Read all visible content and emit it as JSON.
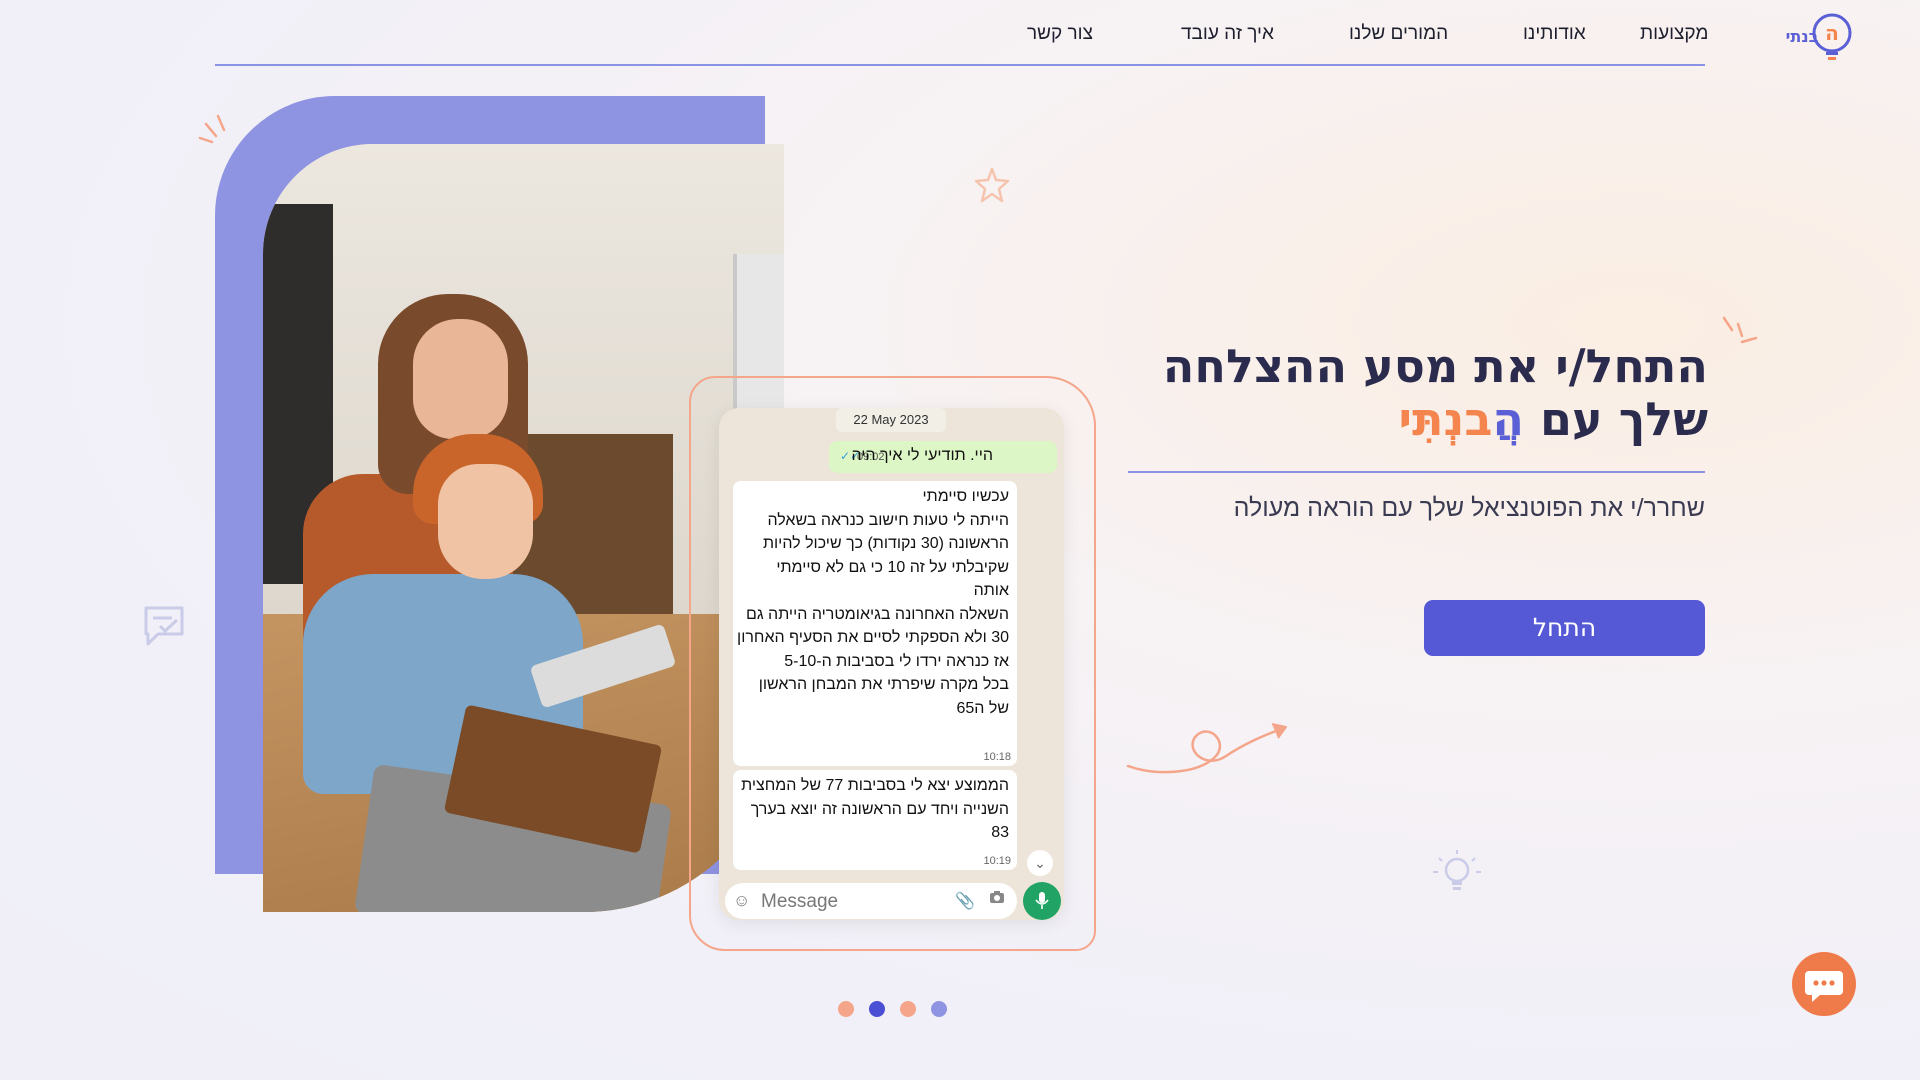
{
  "brand": {
    "logo_name": "הַבְנָתִי"
  },
  "nav": {
    "items": [
      {
        "label": "מקצועות"
      },
      {
        "label": "אודותינו"
      },
      {
        "label": "המורים שלנו"
      },
      {
        "label": "איך זה עובד"
      },
      {
        "label": "צור קשר"
      }
    ]
  },
  "hero": {
    "title_line1": "התחל/י את מסע ההצלחה",
    "title_line2_prefix": "שלך עם",
    "brand_part1": "הֲ",
    "brand_part2": "בנְתִּי",
    "subtitle": "שחרר/י את הפוטנציאל שלך עם הוראה  מעולה",
    "cta_label": "התחל"
  },
  "chat": {
    "date": "22 May 2023",
    "outgoing": {
      "text": "היי. תודיעי לי איך היה",
      "time": "09:02",
      "ticks": "✓✓"
    },
    "incoming": [
      {
        "text": "עכשיו סיימתי\nהייתה לי טעות חישוב כנראה בשאלה הראשונה (30 נקודות) כך שיכול להיות שקיבלתי על זה 10 כי גם לא סיימתי אותה\nהשאלה האחרונה בגיאומטריה הייתה גם 30 ולא הספקתי לסיים את הסעיף האחרון אז כנראה ירדו לי בסביבות ה-5-10\nבכל מקרה שיפרתי את המבחן הראשון של ה65",
        "time": "10:18"
      },
      {
        "text": "הממוצע יצא לי בסביבות 77 של המחצית השנייה ויחד עם הראשונה זה יוצא בערך 83",
        "time": "10:19"
      }
    ],
    "input_placeholder": "Message",
    "icons": {
      "emoji": "smiley-icon",
      "attach": "paperclip-icon",
      "camera": "camera-icon",
      "mic": "microphone-icon",
      "scroll": "chevron-down-icon"
    }
  },
  "carousel": {
    "dot_count": 4,
    "active_index": 1
  },
  "colors": {
    "accent": "#5659d6",
    "orange": "#f07b4a",
    "lavender": "#8f94e2",
    "whatsapp_green": "#22a366"
  }
}
